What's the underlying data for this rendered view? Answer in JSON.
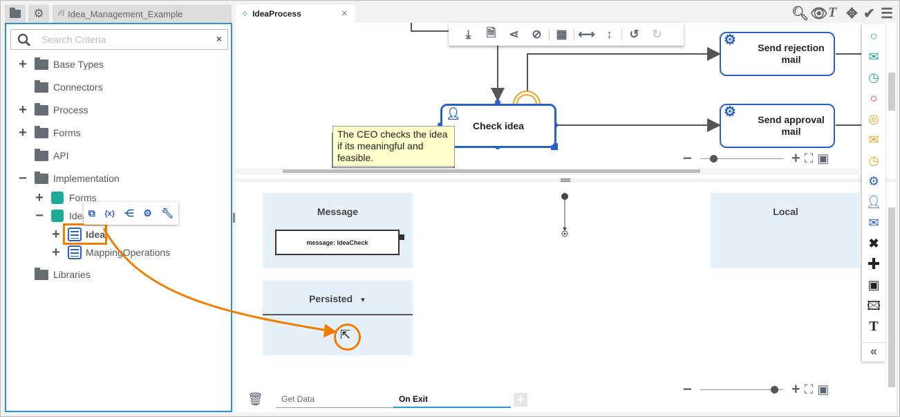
{
  "left_tabs": {
    "explorer_icon": "folder-icon",
    "settings_icon": "gear-icon",
    "project_label": "Idea_Management_Example"
  },
  "search": {
    "placeholder": "Search Criteria",
    "clear": "×"
  },
  "tree": {
    "items": [
      {
        "label": "Base Types",
        "toggle": "+"
      },
      {
        "label": "Connectors",
        "toggle": ""
      },
      {
        "label": "Process",
        "toggle": "+"
      },
      {
        "label": "Forms",
        "toggle": "+"
      },
      {
        "label": "API",
        "toggle": ""
      },
      {
        "label": "Implementation",
        "toggle": "−"
      },
      {
        "label": "Forms",
        "toggle": "+"
      },
      {
        "label": "Idea",
        "toggle": "−"
      },
      {
        "label": "Idea",
        "toggle": "+"
      },
      {
        "label": "MappingOperations",
        "toggle": "+"
      },
      {
        "label": "Libraries",
        "toggle": ""
      }
    ],
    "context_toolbar": [
      "structure-icon",
      "variable-icon",
      "flow-icon",
      "gear-icon",
      "wrench-icon"
    ]
  },
  "editor_tab": {
    "label": "IdeaProcess",
    "close": "×"
  },
  "top_right_icons": [
    "search-icon",
    "eye-icon",
    "text-icon",
    "move-icon",
    "check-icon",
    "list-icon"
  ],
  "diagram_toolbar": [
    "export-icon",
    "document-icon",
    "share-icon",
    "hide-icon",
    "grid-icon",
    "fit-width-icon",
    "fit-height-icon",
    "undo-icon",
    "redo-icon"
  ],
  "diagram": {
    "task_check": "Check idea",
    "task_reject": "Send rejection mail",
    "task_approve": "Send approval mail",
    "annotation": "The CEO checks the idea if its meaningful and feasible."
  },
  "palette": [
    "start-event",
    "message-start",
    "timer-start",
    "end-event",
    "intermediate-event",
    "intermediate-message",
    "intermediate-timer",
    "service-task",
    "user-task",
    "send-task",
    "exclusive-gateway",
    "parallel-gateway",
    "subprocess",
    "image",
    "text",
    "collapse"
  ],
  "colors": {
    "accent": "#2a93d5",
    "task": "#2760c8",
    "highlight": "#f07d00",
    "green": "#1ea896",
    "red": "#e8174a",
    "orange": "#f0a020"
  },
  "mapping": {
    "message_title": "Message",
    "message_item": "message: IdeaCheck",
    "local_title": "Local",
    "persisted_title": "Persisted",
    "tabs": [
      {
        "label": "Get Data",
        "active": false
      },
      {
        "label": "On Exit",
        "active": true
      }
    ],
    "add": "+"
  }
}
